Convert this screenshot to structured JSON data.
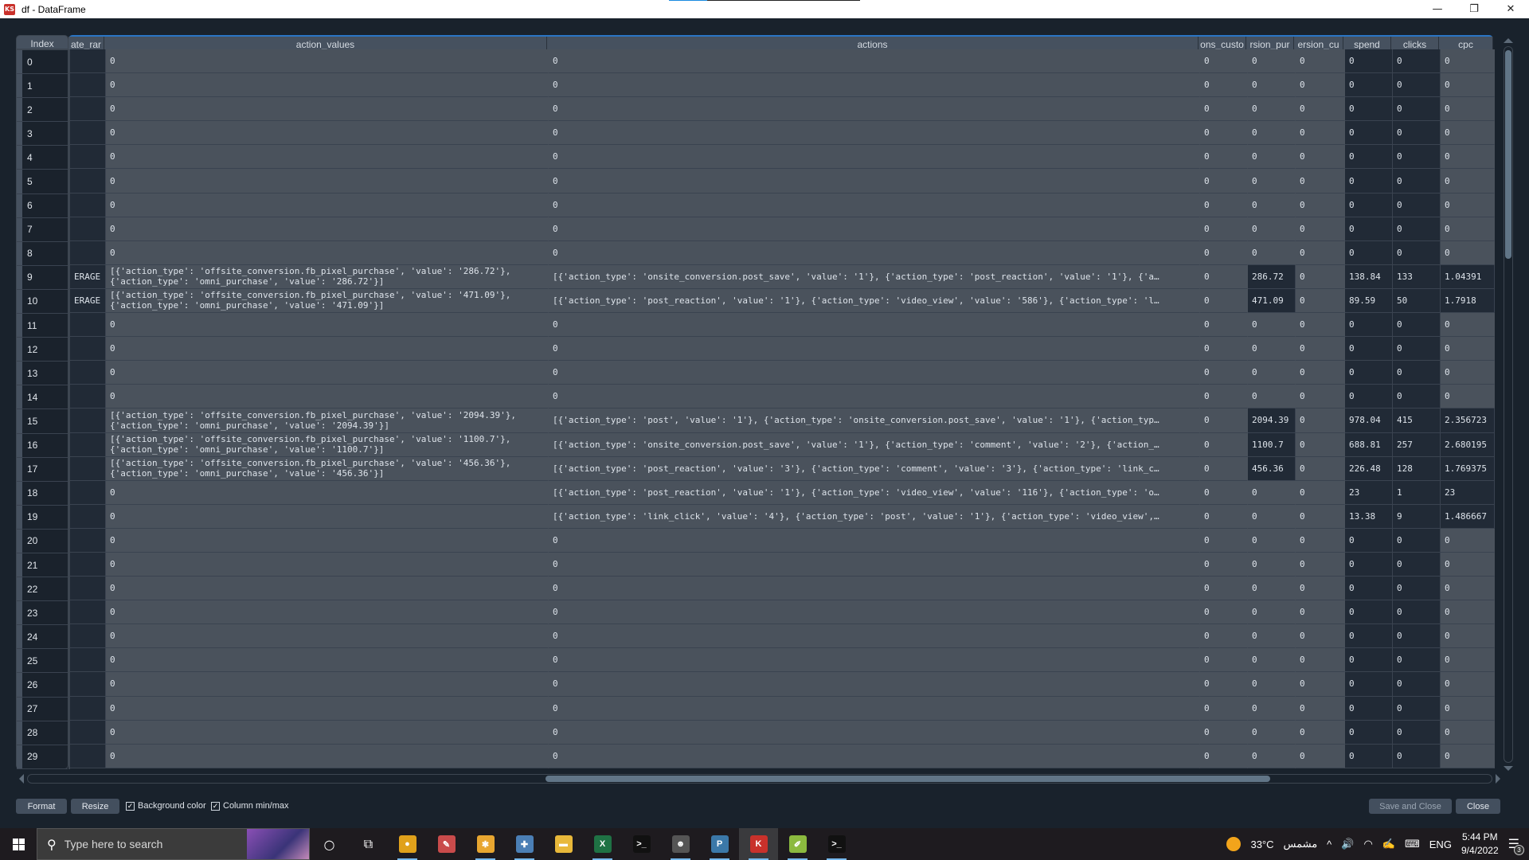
{
  "window": {
    "title": "df - DataFrame",
    "app_icon": "kite-spyder-icon",
    "controls": {
      "minimize": "—",
      "maximize": "❐",
      "close": "✕"
    }
  },
  "table": {
    "columns": [
      {
        "key": "index",
        "label": "Index"
      },
      {
        "key": "ate_rar",
        "label": "ate_rar"
      },
      {
        "key": "action_values",
        "label": "action_values"
      },
      {
        "key": "actions",
        "label": "actions"
      },
      {
        "key": "ons_custo",
        "label": "ons_custo"
      },
      {
        "key": "rsion_pur",
        "label": "rsion_pur"
      },
      {
        "key": "ersion_cu",
        "label": "ersion_cu"
      },
      {
        "key": "spend",
        "label": "spend"
      },
      {
        "key": "clicks",
        "label": "clicks"
      },
      {
        "key": "cpc",
        "label": "cpc"
      }
    ],
    "rows": [
      {
        "index": "0",
        "ate_rar": "",
        "action_values": "0",
        "actions": "0",
        "ons_custo": "0",
        "rsion_pur": "0",
        "ersion_cu": "0",
        "spend": "0",
        "clicks": "0",
        "cpc": "0"
      },
      {
        "index": "1",
        "ate_rar": "",
        "action_values": "0",
        "actions": "0",
        "ons_custo": "0",
        "rsion_pur": "0",
        "ersion_cu": "0",
        "spend": "0",
        "clicks": "0",
        "cpc": "0"
      },
      {
        "index": "2",
        "ate_rar": "",
        "action_values": "0",
        "actions": "0",
        "ons_custo": "0",
        "rsion_pur": "0",
        "ersion_cu": "0",
        "spend": "0",
        "clicks": "0",
        "cpc": "0"
      },
      {
        "index": "3",
        "ate_rar": "",
        "action_values": "0",
        "actions": "0",
        "ons_custo": "0",
        "rsion_pur": "0",
        "ersion_cu": "0",
        "spend": "0",
        "clicks": "0",
        "cpc": "0"
      },
      {
        "index": "4",
        "ate_rar": "",
        "action_values": "0",
        "actions": "0",
        "ons_custo": "0",
        "rsion_pur": "0",
        "ersion_cu": "0",
        "spend": "0",
        "clicks": "0",
        "cpc": "0"
      },
      {
        "index": "5",
        "ate_rar": "",
        "action_values": "0",
        "actions": "0",
        "ons_custo": "0",
        "rsion_pur": "0",
        "ersion_cu": "0",
        "spend": "0",
        "clicks": "0",
        "cpc": "0"
      },
      {
        "index": "6",
        "ate_rar": "",
        "action_values": "0",
        "actions": "0",
        "ons_custo": "0",
        "rsion_pur": "0",
        "ersion_cu": "0",
        "spend": "0",
        "clicks": "0",
        "cpc": "0"
      },
      {
        "index": "7",
        "ate_rar": "",
        "action_values": "0",
        "actions": "0",
        "ons_custo": "0",
        "rsion_pur": "0",
        "ersion_cu": "0",
        "spend": "0",
        "clicks": "0",
        "cpc": "0"
      },
      {
        "index": "8",
        "ate_rar": "",
        "action_values": "0",
        "actions": "0",
        "ons_custo": "0",
        "rsion_pur": "0",
        "ersion_cu": "0",
        "spend": "0",
        "clicks": "0",
        "cpc": "0"
      },
      {
        "index": "9",
        "ate_rar": "ERAGE",
        "action_values": "[{'action_type': 'offsite_conversion.fb_pixel_purchase', 'value': '286.72'},\n{'action_type': 'omni_purchase', 'value': '286.72'}]",
        "actions": "[{'action_type': 'onsite_conversion.post_save', 'value': '1'}, {'action_type': 'post_reaction', 'value': '1'}, {'a…",
        "ons_custo": "0",
        "rsion_pur": "286.72",
        "ersion_cu": "0",
        "spend": "138.84",
        "clicks": "133",
        "cpc": "1.04391",
        "hl": true
      },
      {
        "index": "10",
        "ate_rar": "ERAGE",
        "action_values": "[{'action_type': 'offsite_conversion.fb_pixel_purchase', 'value': '471.09'},\n{'action_type': 'omni_purchase', 'value': '471.09'}]",
        "actions": "[{'action_type': 'post_reaction', 'value': '1'}, {'action_type': 'video_view', 'value': '586'}, {'action_type': 'l…",
        "ons_custo": "0",
        "rsion_pur": "471.09",
        "ersion_cu": "0",
        "spend": "89.59",
        "clicks": "50",
        "cpc": "1.7918",
        "hl": true
      },
      {
        "index": "11",
        "ate_rar": "",
        "action_values": "0",
        "actions": "0",
        "ons_custo": "0",
        "rsion_pur": "0",
        "ersion_cu": "0",
        "spend": "0",
        "clicks": "0",
        "cpc": "0"
      },
      {
        "index": "12",
        "ate_rar": "",
        "action_values": "0",
        "actions": "0",
        "ons_custo": "0",
        "rsion_pur": "0",
        "ersion_cu": "0",
        "spend": "0",
        "clicks": "0",
        "cpc": "0"
      },
      {
        "index": "13",
        "ate_rar": "",
        "action_values": "0",
        "actions": "0",
        "ons_custo": "0",
        "rsion_pur": "0",
        "ersion_cu": "0",
        "spend": "0",
        "clicks": "0",
        "cpc": "0"
      },
      {
        "index": "14",
        "ate_rar": "",
        "action_values": "0",
        "actions": "0",
        "ons_custo": "0",
        "rsion_pur": "0",
        "ersion_cu": "0",
        "spend": "0",
        "clicks": "0",
        "cpc": "0"
      },
      {
        "index": "15",
        "ate_rar": "",
        "action_values": "[{'action_type': 'offsite_conversion.fb_pixel_purchase', 'value': '2094.39'},\n{'action_type': 'omni_purchase', 'value': '2094.39'}]",
        "actions": "[{'action_type': 'post', 'value': '1'}, {'action_type': 'onsite_conversion.post_save', 'value': '1'}, {'action_typ…",
        "ons_custo": "0",
        "rsion_pur": "2094.39",
        "ersion_cu": "0",
        "spend": "978.04",
        "clicks": "415",
        "cpc": "2.356723",
        "hl": true
      },
      {
        "index": "16",
        "ate_rar": "",
        "action_values": "[{'action_type': 'offsite_conversion.fb_pixel_purchase', 'value': '1100.7'},\n{'action_type': 'omni_purchase', 'value': '1100.7'}]",
        "actions": "[{'action_type': 'onsite_conversion.post_save', 'value': '1'}, {'action_type': 'comment', 'value': '2'}, {'action_…",
        "ons_custo": "0",
        "rsion_pur": "1100.7",
        "ersion_cu": "0",
        "spend": "688.81",
        "clicks": "257",
        "cpc": "2.680195",
        "hl": true
      },
      {
        "index": "17",
        "ate_rar": "",
        "action_values": "[{'action_type': 'offsite_conversion.fb_pixel_purchase', 'value': '456.36'},\n{'action_type': 'omni_purchase', 'value': '456.36'}]",
        "actions": "[{'action_type': 'post_reaction', 'value': '3'}, {'action_type': 'comment', 'value': '3'}, {'action_type': 'link_c…",
        "ons_custo": "0",
        "rsion_pur": "456.36",
        "ersion_cu": "0",
        "spend": "226.48",
        "clicks": "128",
        "cpc": "1.769375",
        "hl": true
      },
      {
        "index": "18",
        "ate_rar": "",
        "action_values": "0",
        "actions": "[{'action_type': 'post_reaction', 'value': '1'}, {'action_type': 'video_view', 'value': '116'}, {'action_type': 'o…",
        "ons_custo": "0",
        "rsion_pur": "0",
        "ersion_cu": "0",
        "spend": "23",
        "clicks": "1",
        "cpc": "23",
        "hlcpc": true
      },
      {
        "index": "19",
        "ate_rar": "",
        "action_values": "0",
        "actions": "[{'action_type': 'link_click', 'value': '4'}, {'action_type': 'post', 'value': '1'}, {'action_type': 'video_view',…",
        "ons_custo": "0",
        "rsion_pur": "0",
        "ersion_cu": "0",
        "spend": "13.38",
        "clicks": "9",
        "cpc": "1.486667",
        "hlcpc": true
      },
      {
        "index": "20",
        "ate_rar": "",
        "action_values": "0",
        "actions": "0",
        "ons_custo": "0",
        "rsion_pur": "0",
        "ersion_cu": "0",
        "spend": "0",
        "clicks": "0",
        "cpc": "0"
      },
      {
        "index": "21",
        "ate_rar": "",
        "action_values": "0",
        "actions": "0",
        "ons_custo": "0",
        "rsion_pur": "0",
        "ersion_cu": "0",
        "spend": "0",
        "clicks": "0",
        "cpc": "0"
      },
      {
        "index": "22",
        "ate_rar": "",
        "action_values": "0",
        "actions": "0",
        "ons_custo": "0",
        "rsion_pur": "0",
        "ersion_cu": "0",
        "spend": "0",
        "clicks": "0",
        "cpc": "0"
      },
      {
        "index": "23",
        "ate_rar": "",
        "action_values": "0",
        "actions": "0",
        "ons_custo": "0",
        "rsion_pur": "0",
        "ersion_cu": "0",
        "spend": "0",
        "clicks": "0",
        "cpc": "0"
      },
      {
        "index": "24",
        "ate_rar": "",
        "action_values": "0",
        "actions": "0",
        "ons_custo": "0",
        "rsion_pur": "0",
        "ersion_cu": "0",
        "spend": "0",
        "clicks": "0",
        "cpc": "0"
      },
      {
        "index": "25",
        "ate_rar": "",
        "action_values": "0",
        "actions": "0",
        "ons_custo": "0",
        "rsion_pur": "0",
        "ersion_cu": "0",
        "spend": "0",
        "clicks": "0",
        "cpc": "0"
      },
      {
        "index": "26",
        "ate_rar": "",
        "action_values": "0",
        "actions": "0",
        "ons_custo": "0",
        "rsion_pur": "0",
        "ersion_cu": "0",
        "spend": "0",
        "clicks": "0",
        "cpc": "0"
      },
      {
        "index": "27",
        "ate_rar": "",
        "action_values": "0",
        "actions": "0",
        "ons_custo": "0",
        "rsion_pur": "0",
        "ersion_cu": "0",
        "spend": "0",
        "clicks": "0",
        "cpc": "0"
      },
      {
        "index": "28",
        "ate_rar": "",
        "action_values": "0",
        "actions": "0",
        "ons_custo": "0",
        "rsion_pur": "0",
        "ersion_cu": "0",
        "spend": "0",
        "clicks": "0",
        "cpc": "0"
      },
      {
        "index": "29",
        "ate_rar": "",
        "action_values": "0",
        "actions": "0",
        "ons_custo": "0",
        "rsion_pur": "0",
        "ersion_cu": "0",
        "spend": "0",
        "clicks": "0",
        "cpc": "0"
      }
    ]
  },
  "bottom_bar": {
    "format_label": "Format",
    "resize_label": "Resize",
    "background_color_label": "Background color",
    "background_color_checked": true,
    "column_minmax_label": "Column min/max",
    "column_minmax_checked": true,
    "save_close_label": "Save and Close",
    "close_label": "Close"
  },
  "taskbar": {
    "search_placeholder": "Type here to search",
    "apps": [
      {
        "name": "cortana-icon",
        "glyph": "○"
      },
      {
        "name": "task-view-icon",
        "glyph": "⧉"
      },
      {
        "name": "chrome-icon",
        "glyph": "●",
        "color": "#e0a11b",
        "running": true
      },
      {
        "name": "paint-tool-icon",
        "glyph": "✎",
        "color": "#c94b4b"
      },
      {
        "name": "slack-icon",
        "glyph": "✱",
        "color": "#e8a630",
        "running": true
      },
      {
        "name": "tableau-icon",
        "glyph": "✚",
        "color": "#4b7fb5",
        "running": true
      },
      {
        "name": "file-explorer-icon",
        "glyph": "▬",
        "color": "#e8b83a"
      },
      {
        "name": "excel-icon",
        "glyph": "X",
        "color": "#1f7244",
        "running": true
      },
      {
        "name": "terminal-icon",
        "glyph": ">_",
        "color": "#111111"
      },
      {
        "name": "github-desktop-icon",
        "glyph": "☻",
        "color": "#555555",
        "running": true
      },
      {
        "name": "python-icon",
        "glyph": "P",
        "color": "#3b78a8",
        "running": true
      },
      {
        "name": "kite-spyder-icon",
        "glyph": "K",
        "color": "#c9312b",
        "running": true,
        "active": true
      },
      {
        "name": "notepad-plus-icon",
        "glyph": "✐",
        "color": "#8cba3f",
        "running": true
      },
      {
        "name": "cmd-icon",
        "glyph": ">_",
        "color": "#111111",
        "running": true
      }
    ],
    "weather_temp": "33°C",
    "weather_desc": "مشمس",
    "language": "ENG",
    "time": "5:44 PM",
    "date": "9/4/2022",
    "notification_count": "3"
  },
  "colors": {
    "accent": "#2a75c4",
    "window_bg": "#19222c",
    "cell_grey": "#4a525c",
    "cell_dark": "#212a36",
    "header_bg": "#46515f"
  }
}
